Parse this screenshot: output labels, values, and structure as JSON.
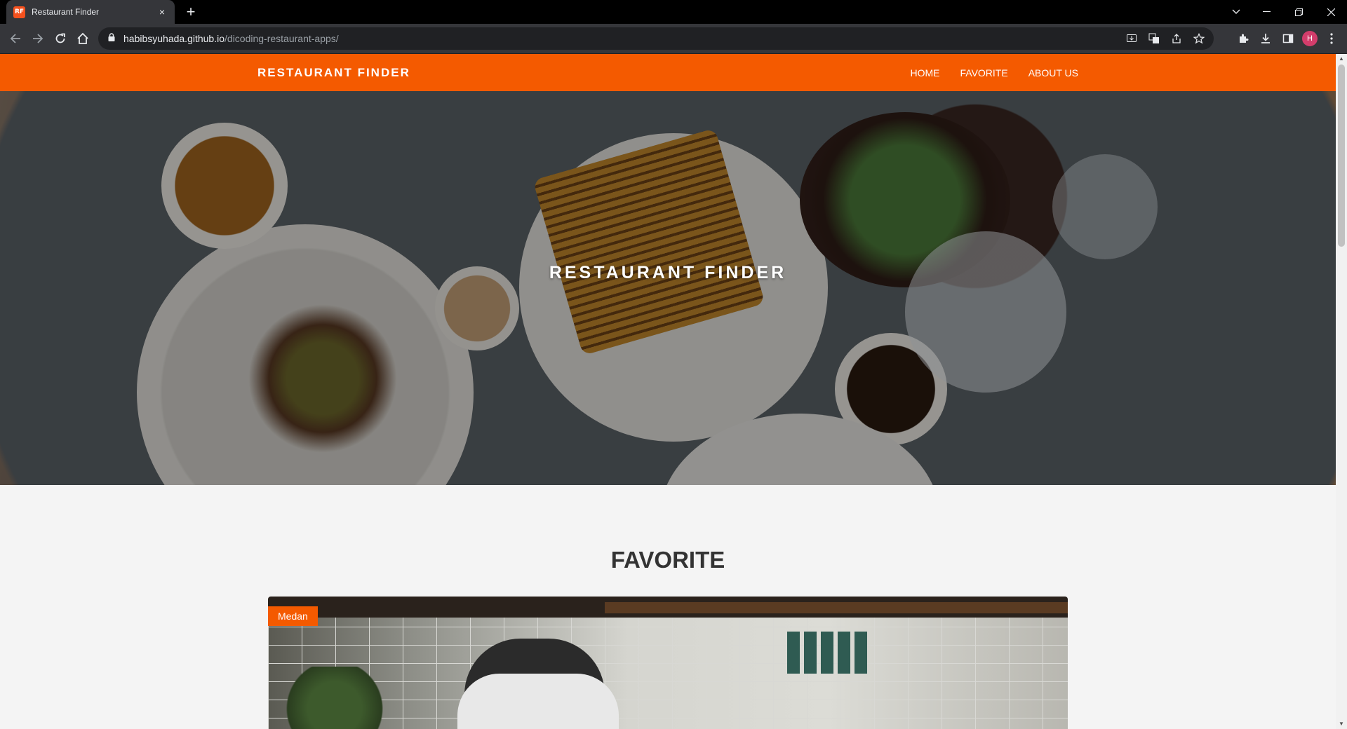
{
  "browser": {
    "tab": {
      "favicon_text": "RF",
      "title": "Restaurant Finder",
      "close": "×"
    },
    "new_tab": "+",
    "url": {
      "host": "habibsyuhada.github.io",
      "path": "/dicoding-restaurant-apps/"
    },
    "profile_initial": "H",
    "icons": [
      "back-icon",
      "forward-icon",
      "reload-icon",
      "home-icon",
      "lock-icon",
      "install-icon",
      "translate-icon",
      "share-icon",
      "star-icon",
      "extensions-icon",
      "download-icon",
      "side-panel-icon",
      "menu-icon"
    ]
  },
  "page": {
    "brand": "RESTAURANT FINDER",
    "nav": [
      "HOME",
      "FAVORITE",
      "ABOUT US"
    ],
    "hero_title": "RESTAURANT FINDER",
    "section_title": "FAVORITE",
    "card": {
      "badge": "Medan"
    }
  },
  "colors": {
    "accent": "#f45a00",
    "background": "#f4f4f4",
    "heading": "#333333"
  }
}
